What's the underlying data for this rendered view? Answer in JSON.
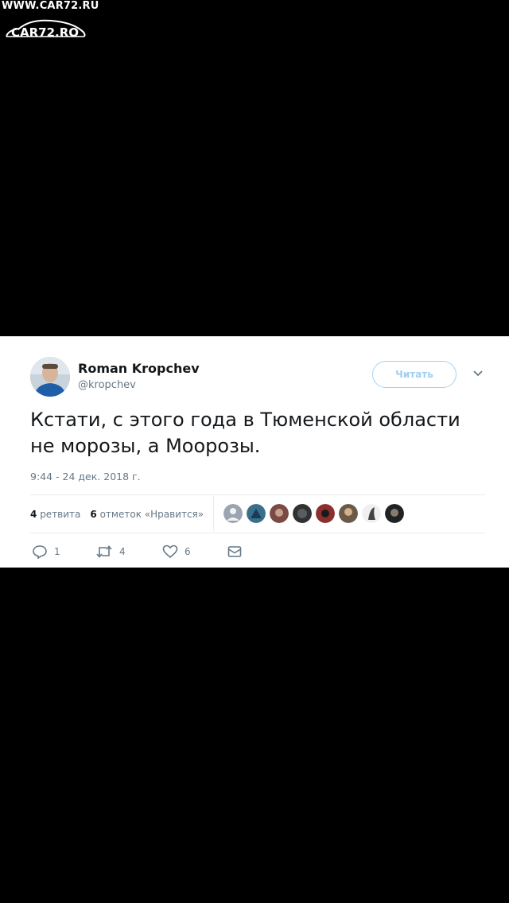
{
  "watermark": {
    "url": "WWW.CAR72.RU",
    "logo_text": "CAR72.RO"
  },
  "tweet": {
    "author_name": "Roman Kropchev",
    "author_handle": "@kropchev",
    "follow_label": "Читать",
    "text_line1": "Кстати, с этого года в Тюменской области",
    "text_line2": "не морозы, а Моорозы.",
    "timestamp": "9:44 - 24 дек. 2018 г.",
    "retweets_count": "4",
    "retweets_label": "ретвита",
    "likes_count": "6",
    "likes_label": "отметок «Нравится»",
    "likers": [
      {
        "color": "#9aa5b1",
        "icon": "default-avatar"
      },
      {
        "color": "#3a6f8c",
        "icon": "avatar"
      },
      {
        "color": "#7a4b45",
        "icon": "avatar"
      },
      {
        "color": "#2f3133",
        "icon": "avatar"
      },
      {
        "color": "#8b2f2f",
        "icon": "avatar"
      },
      {
        "color": "#6b5a4a",
        "icon": "avatar"
      },
      {
        "color": "#444444",
        "icon": "avatar"
      },
      {
        "color": "#1f2326",
        "icon": "avatar"
      }
    ],
    "actions": {
      "reply_count": "1",
      "retweet_count": "4",
      "like_count": "6"
    }
  },
  "colors": {
    "background": "#000000",
    "card": "#ffffff",
    "text": "#14171a",
    "secondary": "#657786",
    "follow_border": "#a6d2f2"
  }
}
